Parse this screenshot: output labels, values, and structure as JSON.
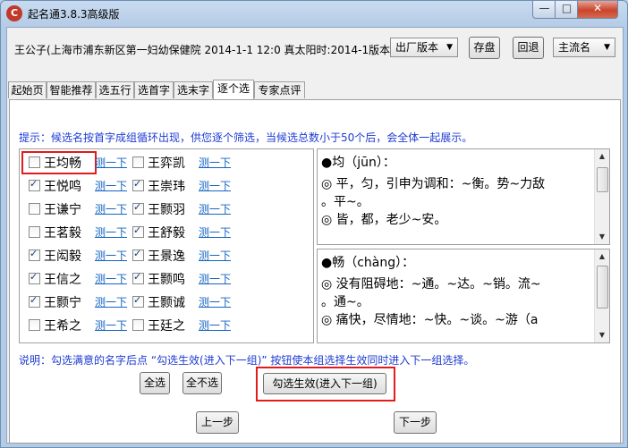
{
  "window": {
    "title": "起名通3.8.3高级版",
    "icon": "app-logo-icon",
    "min": "—",
    "max": "□",
    "close": "✕"
  },
  "toolbar": {
    "info": "王公子(上海市浦东新区第一妇幼保健院 2014-1-1 12:0 真太阳时:2014-1版本:",
    "version_select": "出厂版本",
    "save_label": "存盘",
    "back_label": "回退",
    "mode_select": "主流名"
  },
  "tabs": [
    {
      "label": "起始页",
      "active": false
    },
    {
      "label": "智能推荐",
      "active": false
    },
    {
      "label": "选五行",
      "active": false
    },
    {
      "label": "选首字",
      "active": false
    },
    {
      "label": "选末字",
      "active": false
    },
    {
      "label": "逐个选",
      "active": true
    },
    {
      "label": "专家点评",
      "active": false
    }
  ],
  "hint": "提示：候选名按首字成组循环出现，供您逐个筛选，当候选总数小于50个后，会全体一起展示。",
  "test_link": "测一下",
  "names": {
    "left": [
      {
        "name": "王均畅",
        "checked": false
      },
      {
        "name": "王悦鸣",
        "checked": true
      },
      {
        "name": "王谦宁",
        "checked": false
      },
      {
        "name": "王茗毅",
        "checked": false
      },
      {
        "name": "王闳毅",
        "checked": true
      },
      {
        "name": "王信之",
        "checked": true
      },
      {
        "name": "王颢宁",
        "checked": true
      },
      {
        "name": "王希之",
        "checked": false
      }
    ],
    "right": [
      {
        "name": "王弈凯",
        "checked": false
      },
      {
        "name": "王崇玮",
        "checked": true
      },
      {
        "name": "王颢羽",
        "checked": true
      },
      {
        "name": "王舒毅",
        "checked": true
      },
      {
        "name": "王景逸",
        "checked": true
      },
      {
        "name": "王颢鸣",
        "checked": true
      },
      {
        "name": "王颢诚",
        "checked": true
      },
      {
        "name": "王廷之",
        "checked": false
      }
    ]
  },
  "definitions": [
    {
      "title": "●均（jūn）：",
      "lines": [
        "◎ 平，匀，引申为调和：~衡。势~力敌",
        "。平~。",
        "◎ 皆，都，老少~安。"
      ]
    },
    {
      "title": "●畅（chàng）：",
      "lines": [
        "◎ 没有阻碍地：~通。~达。~销。流~",
        "。通~。",
        "◎ 痛快，尽情地：~快。~谈。~游（a"
      ]
    }
  ],
  "note": "说明：勾选满意的名字后点 “勾选生效(进入下一组)” 按钮使本组选择生效同时进入下一组选择。",
  "buttons": {
    "select_all": "全选",
    "select_none": "全不选",
    "apply": "勾选生效(进入下一组)",
    "prev": "上一步",
    "next": "下一步"
  }
}
